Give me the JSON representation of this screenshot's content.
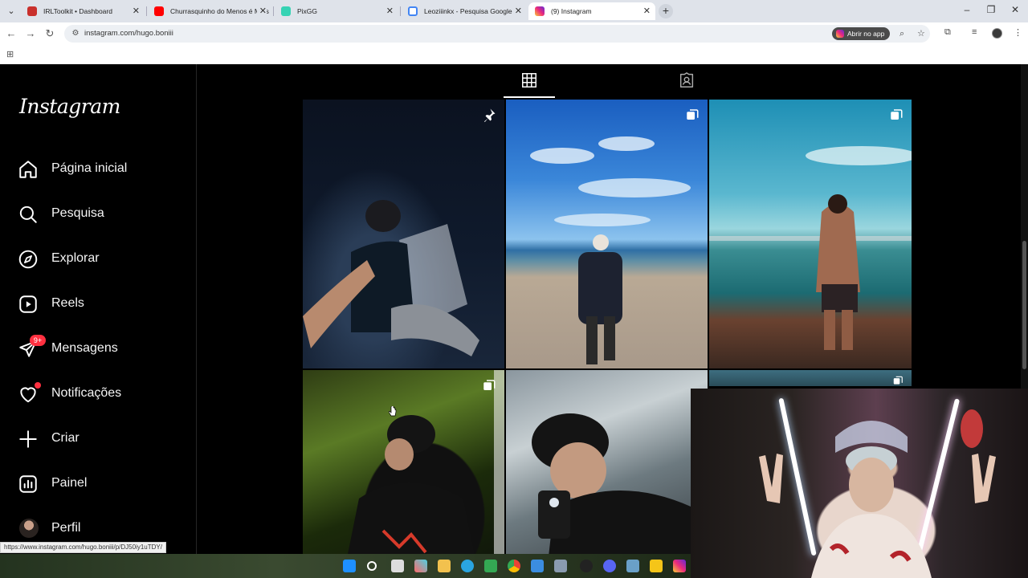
{
  "browser": {
    "tabs": [
      {
        "title": "IRLToolkit • Dashboard",
        "color": "#c9302c"
      },
      {
        "title": "Churrasquinho do Menos é Mais",
        "color": "#ff0000"
      },
      {
        "title": "PixGG",
        "color": "#36d3b4"
      },
      {
        "title": "Leoziiinkx - Pesquisa Google",
        "color": "#4285f4"
      },
      {
        "title": "(9) Instagram",
        "color": "#e1306c"
      }
    ],
    "url": "instagram.com/hugo.boniii",
    "open_app_label": "Abrir no app",
    "status_url": "https://www.instagram.com/hugo.boniii/p/DJ50iy1uTDY/"
  },
  "instagram": {
    "logo": "Instagram",
    "nav": [
      {
        "label": "Página inicial",
        "icon": "home-icon"
      },
      {
        "label": "Pesquisa",
        "icon": "search-icon"
      },
      {
        "label": "Explorar",
        "icon": "compass-icon"
      },
      {
        "label": "Reels",
        "icon": "reels-icon"
      },
      {
        "label": "Mensagens",
        "icon": "messenger-icon",
        "badge": "9+"
      },
      {
        "label": "Notificações",
        "icon": "heart-icon"
      },
      {
        "label": "Criar",
        "icon": "plus-icon"
      },
      {
        "label": "Painel",
        "icon": "dashboard-icon"
      },
      {
        "label": "Perfil",
        "icon": "profile-avatar"
      }
    ],
    "profile_tabs": [
      "grid-icon",
      "tagged-icon"
    ],
    "posts": [
      {
        "id": "p1",
        "overlay": "pin-icon"
      },
      {
        "id": "p2",
        "overlay": "carousel-icon"
      },
      {
        "id": "p3",
        "overlay": "carousel-icon"
      },
      {
        "id": "p4",
        "overlay": "carousel-icon"
      },
      {
        "id": "p5",
        "overlay": ""
      },
      {
        "id": "p6",
        "overlay": "carousel-icon"
      }
    ]
  },
  "colors": {
    "accent_red": "#ff3040",
    "background": "#000000"
  }
}
